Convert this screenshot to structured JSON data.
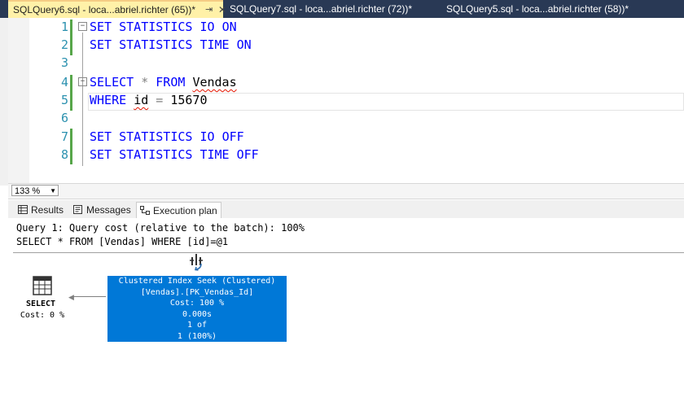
{
  "tabs": [
    {
      "title": "SQLQuery6.sql - loca...abriel.richter (65))*",
      "active": true
    },
    {
      "title": "SQLQuery7.sql - loca...abriel.richter (72))*",
      "active": false
    },
    {
      "title": "SQLQuery5.sql - loca...abriel.richter (58))*",
      "active": false
    }
  ],
  "editor": {
    "lines": [
      {
        "num": "1",
        "text": "SET STATISTICS IO ON"
      },
      {
        "num": "2",
        "text": "SET STATISTICS TIME ON"
      },
      {
        "num": "3",
        "text": ""
      },
      {
        "num": "4",
        "text": "SELECT * FROM Vendas"
      },
      {
        "num": "5",
        "text": "WHERE id = 15670"
      },
      {
        "num": "6",
        "text": ""
      },
      {
        "num": "7",
        "text": "SET STATISTICS IO OFF"
      },
      {
        "num": "8",
        "text": "SET STATISTICS TIME OFF"
      }
    ],
    "tokens": {
      "set": "SET",
      "statistics": "STATISTICS",
      "io": "IO",
      "time": "TIME",
      "on": "ON",
      "off": "OFF",
      "select": "SELECT",
      "star": "*",
      "from": "FROM",
      "table": "Vendas",
      "where": "WHERE",
      "col": "id",
      "eq": "=",
      "value": "15670"
    }
  },
  "zoom": {
    "value": "133 %"
  },
  "result_tabs": [
    {
      "label": "Results"
    },
    {
      "label": "Messages"
    },
    {
      "label": "Execution plan",
      "active": true
    }
  ],
  "plan": {
    "query_header": "Query 1: Query cost (relative to the batch): 100%",
    "query_text": "SELECT * FROM [Vendas] WHERE [id]=@1",
    "select_node": {
      "label": "SELECT",
      "cost": "Cost: 0 %"
    },
    "seek_node": {
      "lines": [
        "Clustered Index Seek (Clustered)",
        "[Vendas].[PK_Vendas_Id]",
        "Cost: 100 %",
        "0.000s",
        "1 of",
        "1 (100%)"
      ]
    }
  },
  "colors": {
    "tab_bar": "#293955",
    "active_tab": "#fff1a8",
    "keyword": "#0000ff",
    "line_number": "#2b91af",
    "selected_node": "#0078d7",
    "change_bar": "#57a64a"
  }
}
